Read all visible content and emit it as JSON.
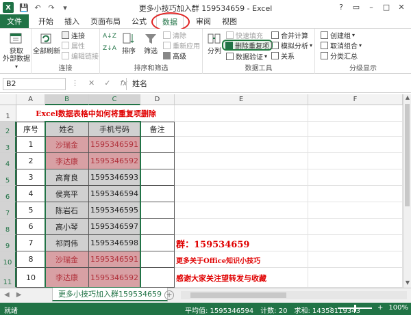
{
  "window": {
    "title": "更多小技巧加入群 159534659 - Excel",
    "app_icon": "X",
    "controls": [
      "?",
      "▭",
      "–",
      "□",
      "✕"
    ]
  },
  "qat": [
    "💾",
    "↶",
    "↷",
    "▾"
  ],
  "tabs": {
    "file": "文件",
    "items": [
      "开始",
      "插入",
      "页面布局",
      "公式",
      "数据",
      "审阅",
      "视图"
    ],
    "active": "数据"
  },
  "ribbon": {
    "get_external": {
      "label": "获取\n外部数据",
      "arrow": "▾"
    },
    "connections": {
      "refresh_all": "全部刷新",
      "connections": "连接",
      "properties": "属性",
      "edit_links": "编辑链接",
      "group_label": "连接"
    },
    "sort_filter": {
      "sort_az": "A↓Z",
      "sort_za": "Z↓A",
      "sort": "排序",
      "filter": "筛选",
      "clear": "清除",
      "reapply": "重新应用",
      "advanced": "高级",
      "group_label": "排序和筛选"
    },
    "data_tools": {
      "text_to_columns": "分列",
      "flash_fill": "快速填充",
      "remove_duplicates": "删除重复项",
      "data_validation": "数据验证",
      "consolidate": "合并计算",
      "what_if": "模拟分析",
      "relationships": "关系",
      "group_label": "数据工具"
    },
    "outline": {
      "group": "创建组",
      "ungroup": "取消组合",
      "subtotal": "分类汇总",
      "group_label": "分级显示"
    }
  },
  "formula_bar": {
    "name_box": "B2",
    "icons": [
      "⋮",
      "✕",
      "✓",
      "fx"
    ],
    "value": "姓名"
  },
  "grid": {
    "columns": [
      "A",
      "B",
      "C",
      "D",
      "E",
      "F"
    ],
    "rows": [
      "1",
      "2",
      "3",
      "4",
      "5",
      "6",
      "7",
      "8",
      "9",
      "10",
      "11"
    ],
    "title": "Excel数据表格中如何将重复项删除",
    "headers": [
      "序号",
      "姓名",
      "手机号码",
      "备注"
    ],
    "data": [
      {
        "no": "1",
        "name": "沙瑞金",
        "phone": "1595346591",
        "dup": true
      },
      {
        "no": "2",
        "name": "李达康",
        "phone": "1595346592",
        "dup": true
      },
      {
        "no": "3",
        "name": "高育良",
        "phone": "1595346593",
        "dup": false
      },
      {
        "no": "4",
        "name": "侯亮平",
        "phone": "1595346594",
        "dup": false
      },
      {
        "no": "5",
        "name": "陈岩石",
        "phone": "1595346595",
        "dup": false
      },
      {
        "no": "6",
        "name": "高小琴",
        "phone": "1595346597",
        "dup": false
      },
      {
        "no": "7",
        "name": "祁同伟",
        "phone": "1595346598",
        "dup": false
      },
      {
        "no": "8",
        "name": "沙瑞金",
        "phone": "1595346591",
        "dup": true
      },
      {
        "no": "10",
        "name": "李达康",
        "phone": "1595346592",
        "dup": true
      }
    ],
    "notes": {
      "r9": "群：159534659",
      "r10": "更多关于Office知识小技巧",
      "r11": "感谢大家关注望转发与收藏"
    }
  },
  "sheet_tabs": {
    "nav": [
      "◀",
      "▶"
    ],
    "active": "更多小技巧加入群159534659",
    "add": "+"
  },
  "status": {
    "ready": "就绪",
    "average": "平均值: 1595346594",
    "count": "计数: 20",
    "sum": "求和: 14358119343",
    "zoom": "100%",
    "zoom_minus": "–",
    "zoom_plus": "+"
  },
  "colors": {
    "excel_green": "#217346",
    "duplicate_fill": "#d8a0a4",
    "header_fill": "#d0d0d0",
    "note_red": "#e00000"
  }
}
